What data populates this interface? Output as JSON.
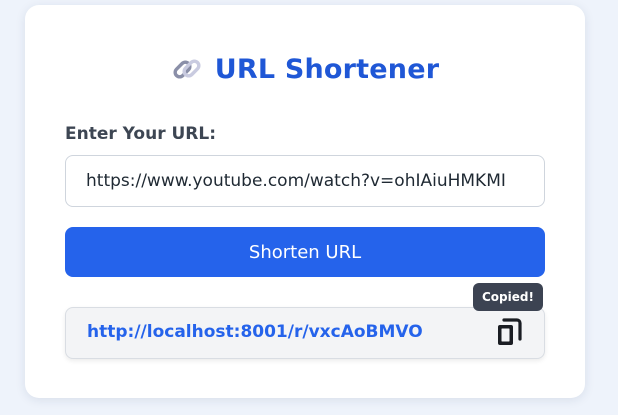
{
  "app": {
    "title": "URL Shortener",
    "title_icon": "link-icon"
  },
  "form": {
    "url_label": "Enter Your URL:",
    "url_value": "https://www.youtube.com/watch?v=ohIAiuHMKMI",
    "submit_label": "Shorten URL"
  },
  "result": {
    "short_url": "http://localhost:8001/r/vxcAoBMVO",
    "copy_icon": "copy-icon",
    "tooltip": "Copied!"
  },
  "colors": {
    "accent": "#2563eb",
    "title": "#1f57d6",
    "background": "#eef3fb",
    "tooltip_bg": "#3c4352"
  }
}
